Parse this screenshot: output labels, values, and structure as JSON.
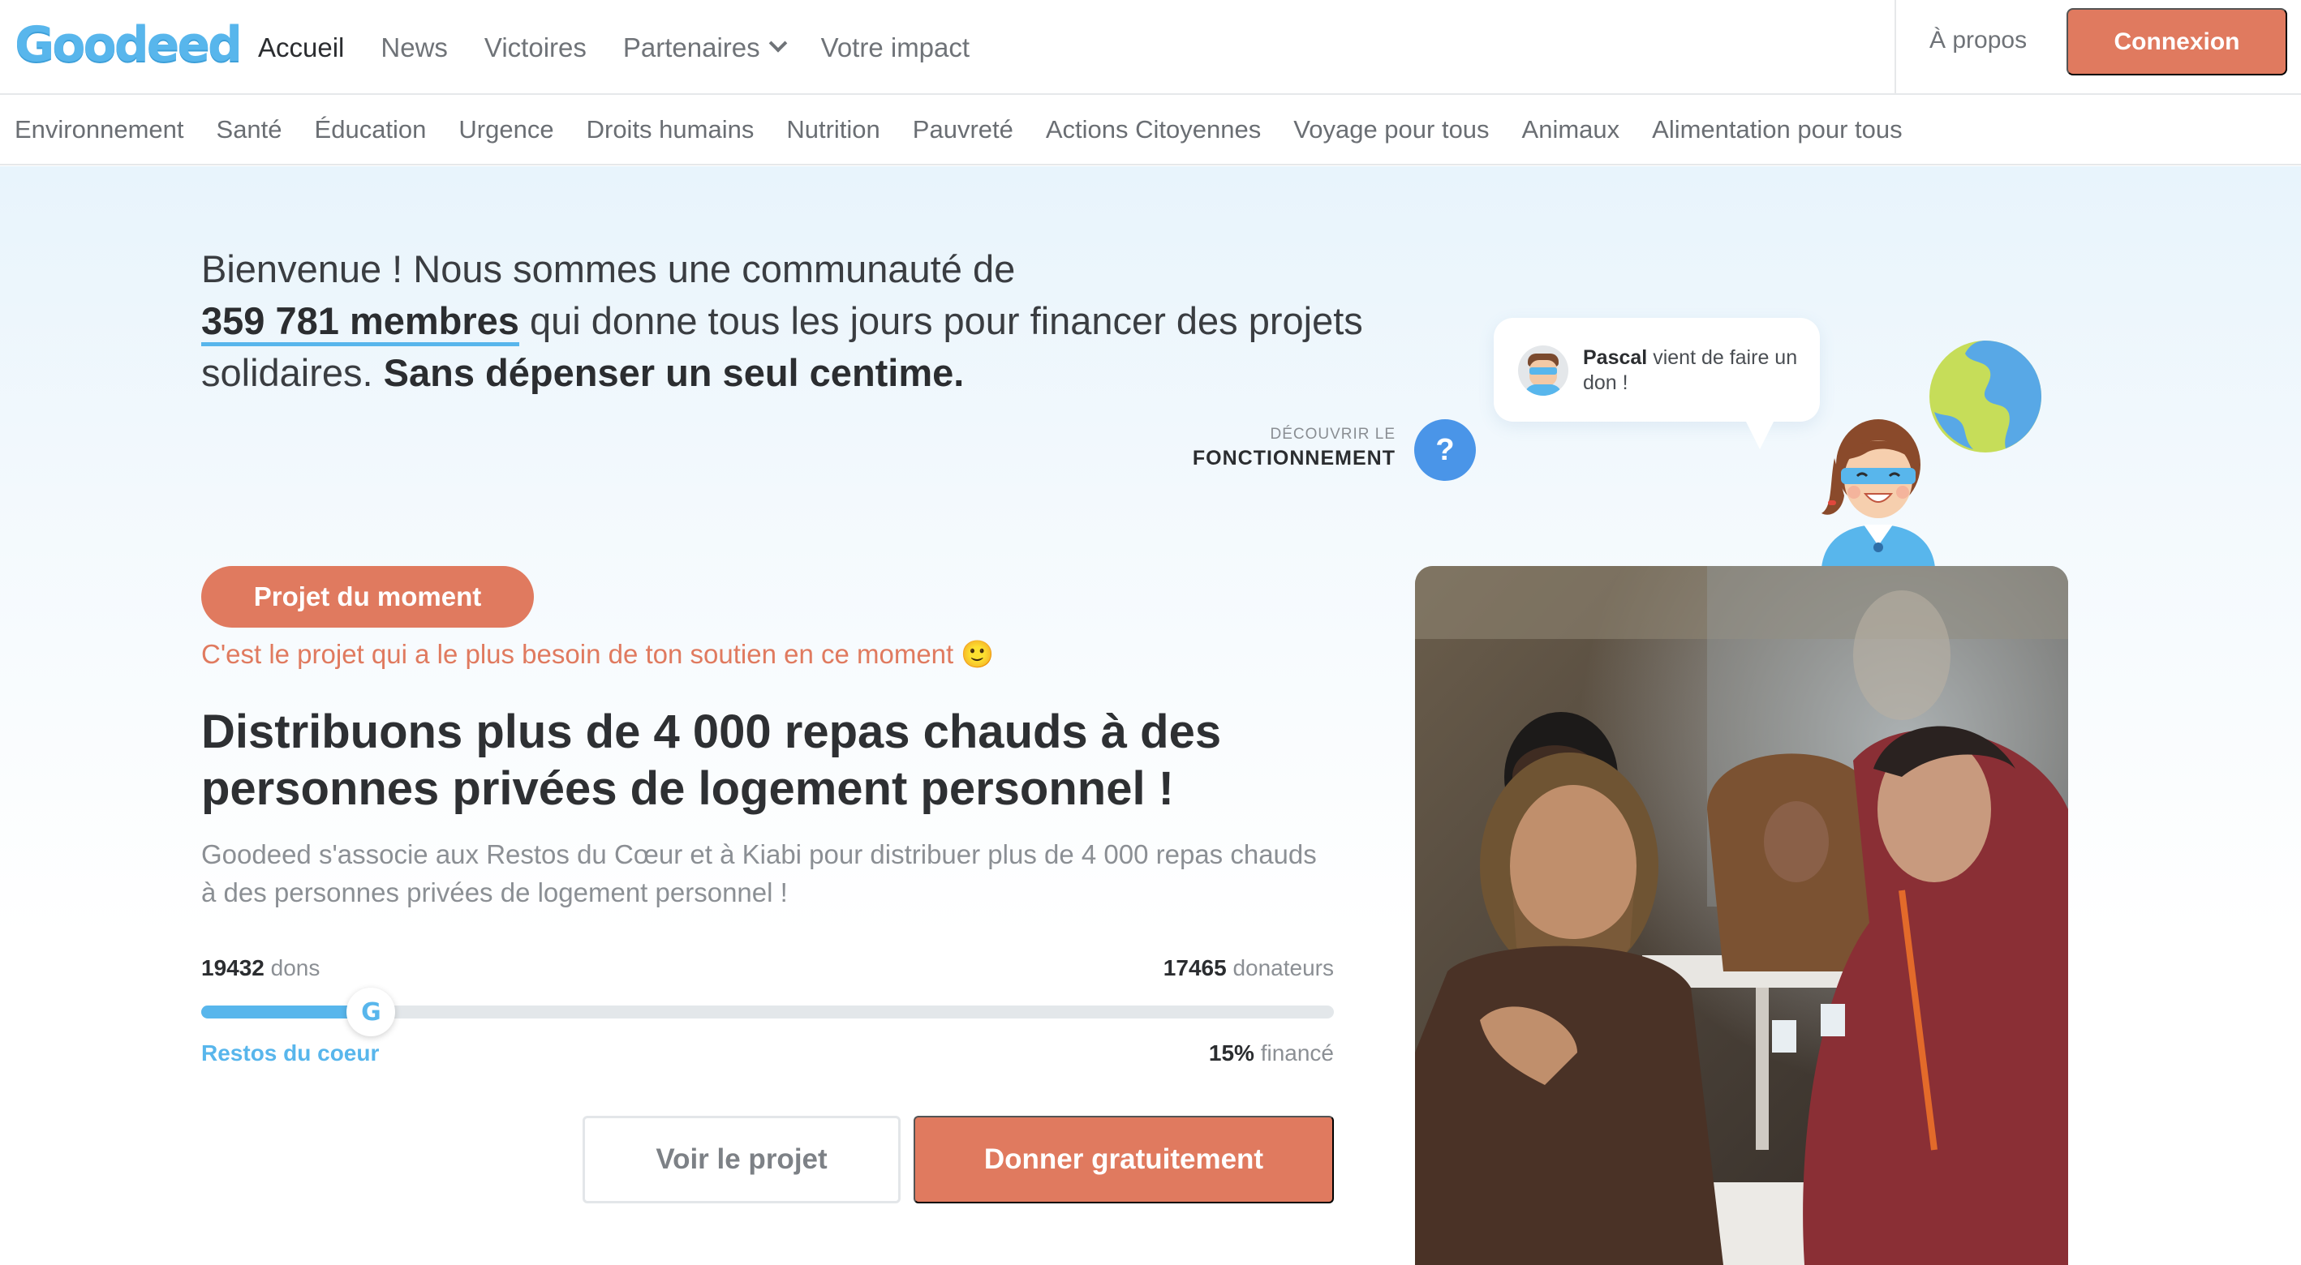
{
  "brand": {
    "name": "Goodeed",
    "color": "#58b6ec",
    "accent": "#e07a5f"
  },
  "nav": {
    "items": [
      {
        "label": "Accueil",
        "active": true
      },
      {
        "label": "News"
      },
      {
        "label": "Victoires"
      },
      {
        "label": "Partenaires",
        "dropdown": true
      },
      {
        "label": "Votre impact"
      }
    ],
    "about": "À propos",
    "login": "Connexion"
  },
  "categories": [
    "Environnement",
    "Santé",
    "Éducation",
    "Urgence",
    "Droits humains",
    "Nutrition",
    "Pauvreté",
    "Actions Citoyennes",
    "Voyage pour tous",
    "Animaux",
    "Alimentation pour tous"
  ],
  "hero": {
    "welcome_pre": "Bienvenue ! Nous sommes une communauté de",
    "members": "359 781 membres",
    "welcome_mid": "qui donne tous les jours pour financer des projets solidaires.",
    "welcome_bold": "Sans dépenser un seul centime.",
    "discover_small": "DÉCOUVRIR LE",
    "discover_big": "FONCTIONNEMENT",
    "help_icon": "?",
    "notification": {
      "name": "Pascal",
      "text": "vient de faire un don !"
    }
  },
  "project": {
    "badge": "Projet du moment",
    "tagline": "C'est le projet qui a le plus besoin de ton soutien en ce moment 🙂",
    "title": "Distribuons plus de 4 000 repas chauds à des personnes privées de logement personnel !",
    "description": "Goodeed s'associe aux Restos du Cœur et à Kiabi pour distribuer plus de 4 000 repas chauds à des personnes privées de logement personnel !",
    "dons_count": "19432",
    "dons_label": "dons",
    "donors_count": "17465",
    "donors_label": "donateurs",
    "progress_percent": 15,
    "knob_letter": "G",
    "partner": "Restos du coeur",
    "funded_value": "15%",
    "funded_label": "financé",
    "btn_view": "Voir le projet",
    "btn_donate": "Donner gratuitement"
  }
}
